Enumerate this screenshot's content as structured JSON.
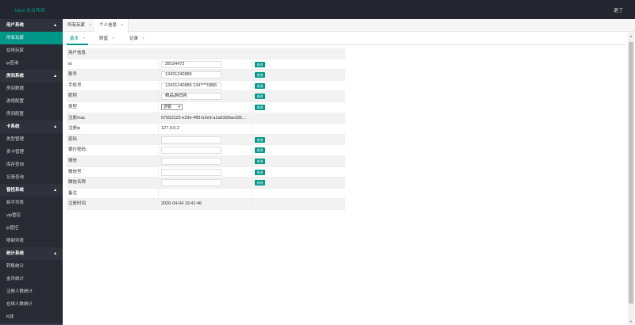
{
  "header": {
    "logo": "layui 后台布局",
    "logout": "退了"
  },
  "sidebar": {
    "groups": [
      {
        "title": "用户系统",
        "items": [
          "所有玩家",
          "在线玩家",
          "ip查询"
        ]
      },
      {
        "title": "房间系统",
        "items": [
          "房间数据",
          "游戏配置",
          "房间配置"
        ]
      },
      {
        "title": "卡系统",
        "items": [
          "类型管理",
          "卖卡管理",
          "库存查询",
          "记录查询"
        ]
      },
      {
        "title": "管控系统",
        "items": [
          "新手列表",
          "vip管控",
          "ip管控",
          "限制列表"
        ]
      },
      {
        "title": "统计系统",
        "items": [
          "转账统计",
          "金币统计",
          "注册人数统计",
          "在线人数统计",
          "K线"
        ]
      }
    ],
    "active_item": "所有玩家"
  },
  "tabs": [
    {
      "label": "所有玩家",
      "close": "×"
    },
    {
      "label": "个人信息",
      "close": "×"
    }
  ],
  "subtabs": [
    {
      "label": "基本",
      "close": "×"
    },
    {
      "label": "财富",
      "close": "×"
    },
    {
      "label": "记录",
      "close": "×"
    }
  ],
  "table": {
    "header": "用户信息",
    "edit_label": "修改",
    "rows": [
      {
        "label": "id",
        "kind": "input",
        "value": "28194472",
        "edit": true
      },
      {
        "label": "账号",
        "kind": "input",
        "value": "13431240886",
        "edit": true
      },
      {
        "label": "手机号",
        "kind": "input",
        "value": "13431240886 134****0886",
        "edit": true
      },
      {
        "label": "昵称",
        "kind": "input",
        "value": "精品游码网",
        "edit": true
      },
      {
        "label": "类型",
        "kind": "select",
        "value": "游客",
        "edit": true
      },
      {
        "label": "注册mac",
        "kind": "text",
        "value": "67652223-e23e-4ff3-b2e9-a1a63d0ae335...",
        "edit": false
      },
      {
        "label": "注册ip",
        "kind": "text",
        "value": "127.0.0.2",
        "edit": false
      },
      {
        "label": "密码",
        "kind": "input",
        "value": "",
        "edit": true
      },
      {
        "label": "银行密码",
        "kind": "input",
        "value": "",
        "edit": true
      },
      {
        "label": "微信",
        "kind": "input",
        "value": "",
        "edit": true
      },
      {
        "label": "微信号",
        "kind": "input",
        "value": "",
        "edit": true
      },
      {
        "label": "微信名称",
        "kind": "input",
        "value": "",
        "edit": true
      },
      {
        "label": "备注",
        "kind": "text",
        "value": "",
        "edit": false
      },
      {
        "label": "注册时间",
        "kind": "text",
        "value": "2026-04-04 19:41:46",
        "edit": false
      }
    ]
  },
  "colors": {
    "accent": "#009688",
    "topbar": "#23262e",
    "sidebar": "#393d49"
  }
}
